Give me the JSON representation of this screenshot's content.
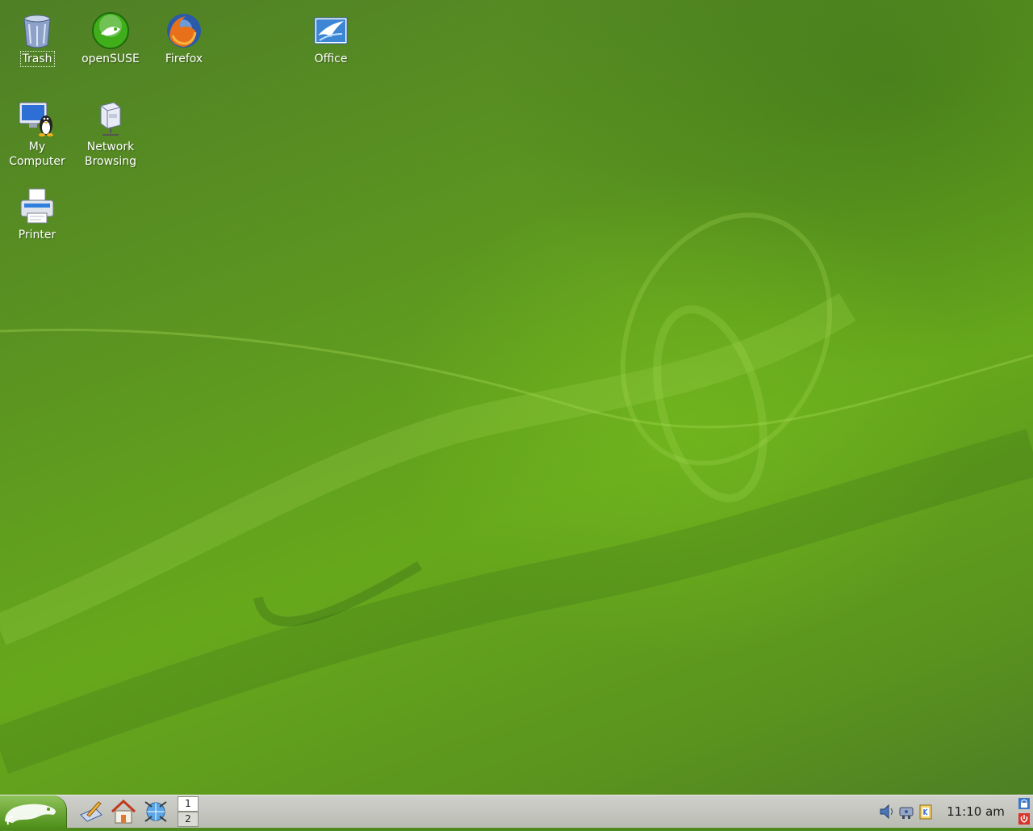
{
  "desktop": {
    "icons": [
      {
        "label": "Trash",
        "icon": "trash-icon",
        "selected": true
      },
      {
        "label": "openSUSE",
        "icon": "opensuse-icon"
      },
      {
        "label": "Firefox",
        "icon": "firefox-icon"
      },
      {
        "label": "Office",
        "icon": "office-icon"
      },
      {
        "label": "My\nComputer",
        "icon": "my-computer-icon"
      },
      {
        "label": "Network\nBrowsing",
        "icon": "network-browsing-icon"
      },
      {
        "label": "Printer",
        "icon": "printer-icon"
      }
    ]
  },
  "taskbar": {
    "start_icon": "opensuse-gecko-icon",
    "launchers": [
      {
        "icon": "desktop-editor-icon"
      },
      {
        "icon": "home-folder-icon"
      },
      {
        "icon": "network-globe-icon"
      }
    ],
    "pager": {
      "desktops": [
        "1",
        "2"
      ],
      "active": "1"
    },
    "tray": [
      {
        "icon": "volume-icon"
      },
      {
        "icon": "network-card-icon"
      },
      {
        "icon": "klipper-clipboard-icon"
      }
    ],
    "clock": "11:10 am",
    "session_icons": [
      "lock-screen-icon",
      "logout-icon"
    ]
  },
  "colors": {
    "wallpaper": "#5c9620",
    "taskbar": "#c4c6bf",
    "start_button": "#6aa632"
  }
}
